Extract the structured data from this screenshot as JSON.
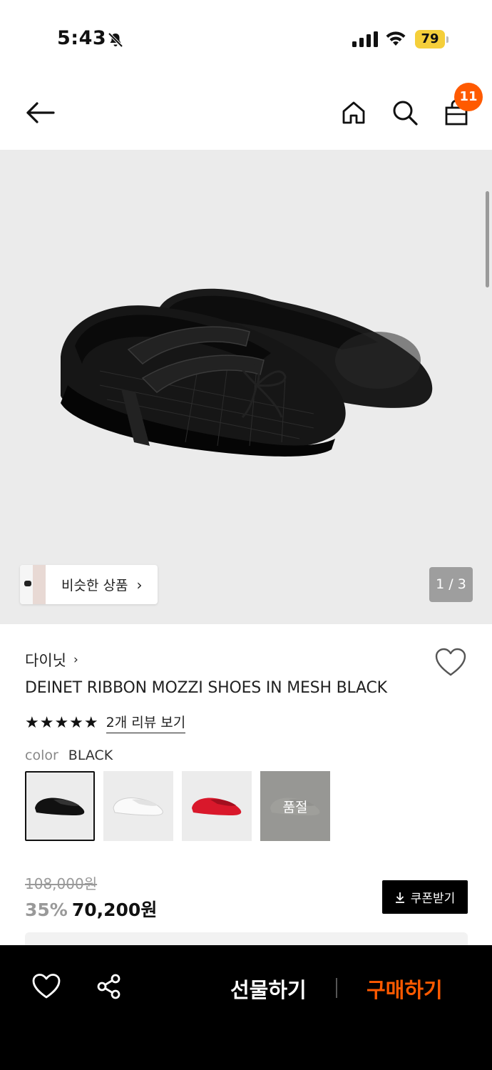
{
  "status_bar": {
    "time": "5:43",
    "battery": "79"
  },
  "header": {
    "cart_count": "11"
  },
  "hero": {
    "similar_label": "비슷한 상품",
    "page_indicator": "1 / 3"
  },
  "product": {
    "brand": "다이닛",
    "title": "DEINET RIBBON MOZZI SHOES IN MESH BLACK",
    "stars": "★★★★★",
    "review_link": "2개 리뷰 보기",
    "color_label": "color",
    "color_value": "BLACK",
    "swatches": [
      {
        "color": "#111111",
        "selected": true
      },
      {
        "color": "#f4f4f4",
        "selected": false
      },
      {
        "color": "#d9182b",
        "selected": false
      },
      {
        "color": "#bdbdb6",
        "soldout_label": "품절"
      }
    ],
    "original_price": "108,000원",
    "discount": "35%",
    "final_price": "70,200원",
    "coupon_label": "쿠폰받기"
  },
  "bottom_bar": {
    "gift_label": "선물하기",
    "buy_label": "구매하기"
  },
  "colors": {
    "accent": "#ff5a00",
    "hero_bg": "#ebebeb"
  }
}
